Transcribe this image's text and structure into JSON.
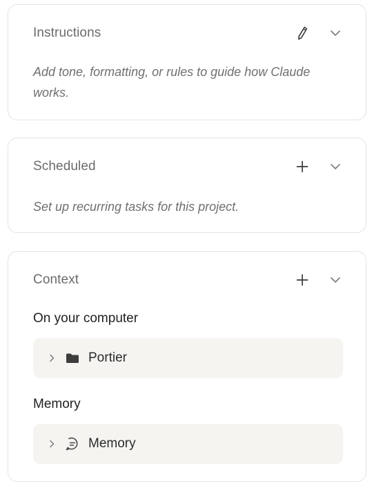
{
  "instructions": {
    "title": "Instructions",
    "description": "Add tone, formatting, or rules to guide how Claude works."
  },
  "scheduled": {
    "title": "Scheduled",
    "description": "Set up recurring tasks for this project."
  },
  "context": {
    "title": "Context",
    "local_heading": "On your computer",
    "local_items": [
      {
        "label": "Portier",
        "icon": "folder-icon"
      }
    ],
    "memory_heading": "Memory",
    "memory_items": [
      {
        "label": "Memory",
        "icon": "memory-icon"
      }
    ]
  },
  "colors": {
    "border": "#e6e3de",
    "row_background": "#f5f4f1",
    "muted_text": "#6b6b6b",
    "text": "#2b2b2b"
  }
}
